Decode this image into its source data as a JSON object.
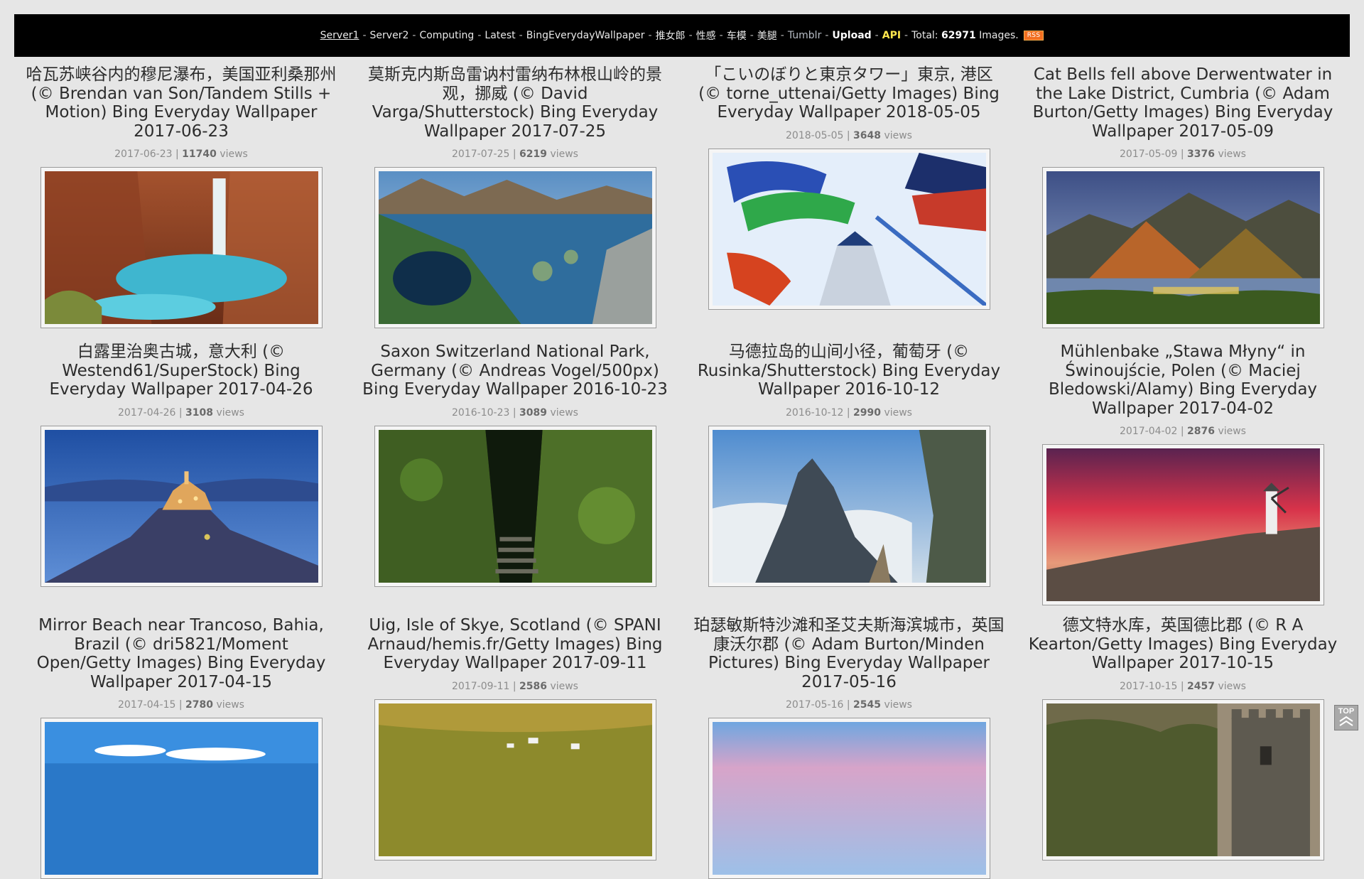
{
  "nav": {
    "server1": "Server1",
    "server2": "Server2",
    "computing": "Computing",
    "latest": "Latest",
    "bing": "BingEverydayWallpaper",
    "tag1": "推女郎",
    "tag2": "性感",
    "tag3": "车模",
    "tag4": "美腿",
    "tumblr": "Tumblr",
    "upload": "Upload",
    "api": "API",
    "total_prefix": "Total:",
    "total_count": "62971",
    "total_suffix": "Images.",
    "rss": "RSS",
    "separator": "-"
  },
  "views_label": "views",
  "top_button": {
    "label": "TOP"
  },
  "cards": [
    {
      "title": "哈瓦苏峡谷内的穆尼瀑布，美国亚利桑那州 (© Brendan van Son/Tandem Stills + Motion) Bing Everyday Wallpaper 2017-06-23",
      "date": "2017-06-23",
      "views": "11740"
    },
    {
      "title": "莫斯克内斯岛雷讷村雷纳布林根山岭的景观，挪威 (© David Varga/Shutterstock) Bing Everyday Wallpaper 2017-07-25",
      "date": "2017-07-25",
      "views": "6219"
    },
    {
      "title": "「こいのぼりと東京タワー」東京, 港区 (© torne_uttenai/Getty Images) Bing Everyday Wallpaper 2018-05-05",
      "date": "2018-05-05",
      "views": "3648"
    },
    {
      "title": "Cat Bells fell above Derwentwater in the Lake District, Cumbria (© Adam Burton/Getty Images) Bing Everyday Wallpaper 2017-05-09",
      "date": "2017-05-09",
      "views": "3376"
    },
    {
      "title": "白露里治奥古城，意大利 (© Westend61/SuperStock) Bing Everyday Wallpaper 2017-04-26",
      "date": "2017-04-26",
      "views": "3108"
    },
    {
      "title": "Saxon Switzerland National Park, Germany (© Andreas Vogel/500px) Bing Everyday Wallpaper 2016-10-23",
      "date": "2016-10-23",
      "views": "3089"
    },
    {
      "title": "马德拉岛的山间小径，葡萄牙 (© Rusinka/Shutterstock) Bing Everyday Wallpaper 2016-10-12",
      "date": "2016-10-12",
      "views": "2990"
    },
    {
      "title": "Mühlenbake „Stawa Młyny“ in Świnoujście, Polen (© Maciej Bledowski/Alamy) Bing Everyday Wallpaper 2017-04-02",
      "date": "2017-04-02",
      "views": "2876"
    },
    {
      "title": "Mirror Beach near Trancoso, Bahia, Brazil (© dri5821/Moment Open/Getty Images) Bing Everyday Wallpaper 2017-04-15",
      "date": "2017-04-15",
      "views": "2780"
    },
    {
      "title": "Uig, Isle of Skye, Scotland (© SPANI Arnaud/hemis.fr/Getty Images) Bing Everyday Wallpaper 2017-09-11",
      "date": "2017-09-11",
      "views": "2586"
    },
    {
      "title": "珀瑟敏斯特沙滩和圣艾夫斯海滨城市，英国康沃尔郡 (© Adam Burton/Minden Pictures) Bing Everyday Wallpaper 2017-05-16",
      "date": "2017-05-16",
      "views": "2545"
    },
    {
      "title": "德文特水库，英国德比郡 (© R A Kearton/Getty Images) Bing Everyday Wallpaper 2017-10-15",
      "date": "2017-10-15",
      "views": "2457"
    }
  ]
}
